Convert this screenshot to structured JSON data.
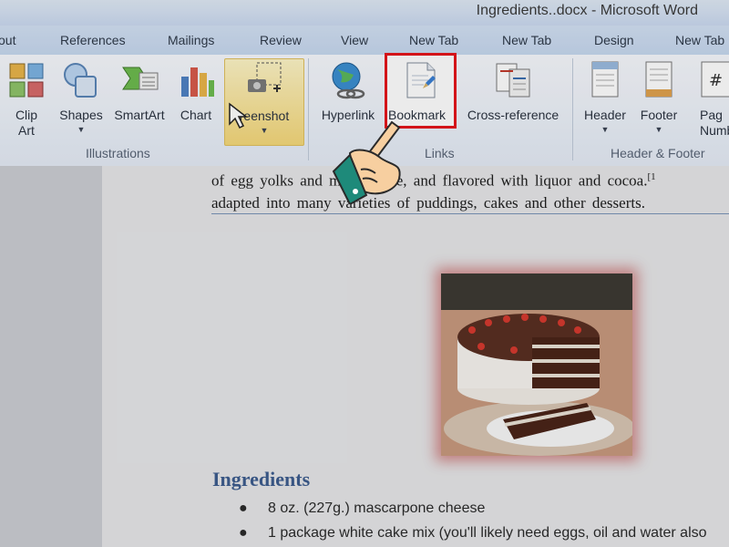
{
  "window": {
    "title": "Ingredients..docx - Microsoft Word"
  },
  "ribbon_tabs": [
    "out",
    "References",
    "Mailings",
    "Review",
    "View",
    "New Tab",
    "New Tab",
    "Design",
    "New Tab"
  ],
  "ribbon": {
    "groups": {
      "illustrations": "Illustrations",
      "links": "Links",
      "header_footer": "Header & Footer"
    },
    "buttons": {
      "clip_art": "Clip\nArt",
      "shapes": "Shapes",
      "smartart": "SmartArt",
      "chart": "Chart",
      "screenshot": "reenshot",
      "hyperlink": "Hyperlink",
      "bookmark": "Bookmark",
      "cross_reference": "Cross-reference",
      "header": "Header",
      "footer": "Footer",
      "page_number": "Pag\nNumb"
    }
  },
  "document": {
    "intro_lines": [
      "of egg yolks and mascarpone,  and flavored with liquor and cocoa.",
      "adapted into many varieties of puddings, cakes and other desserts."
    ],
    "footnote_mark": "[1",
    "heading": "Ingredients",
    "list_items": [
      "8 oz. (227g.) mascarpone cheese",
      "1 package white cake mix (you'll likely need eggs, oil and water also"
    ]
  },
  "colors": {
    "highlight_border": "#e5161c",
    "heading": "#3d5d8f"
  }
}
